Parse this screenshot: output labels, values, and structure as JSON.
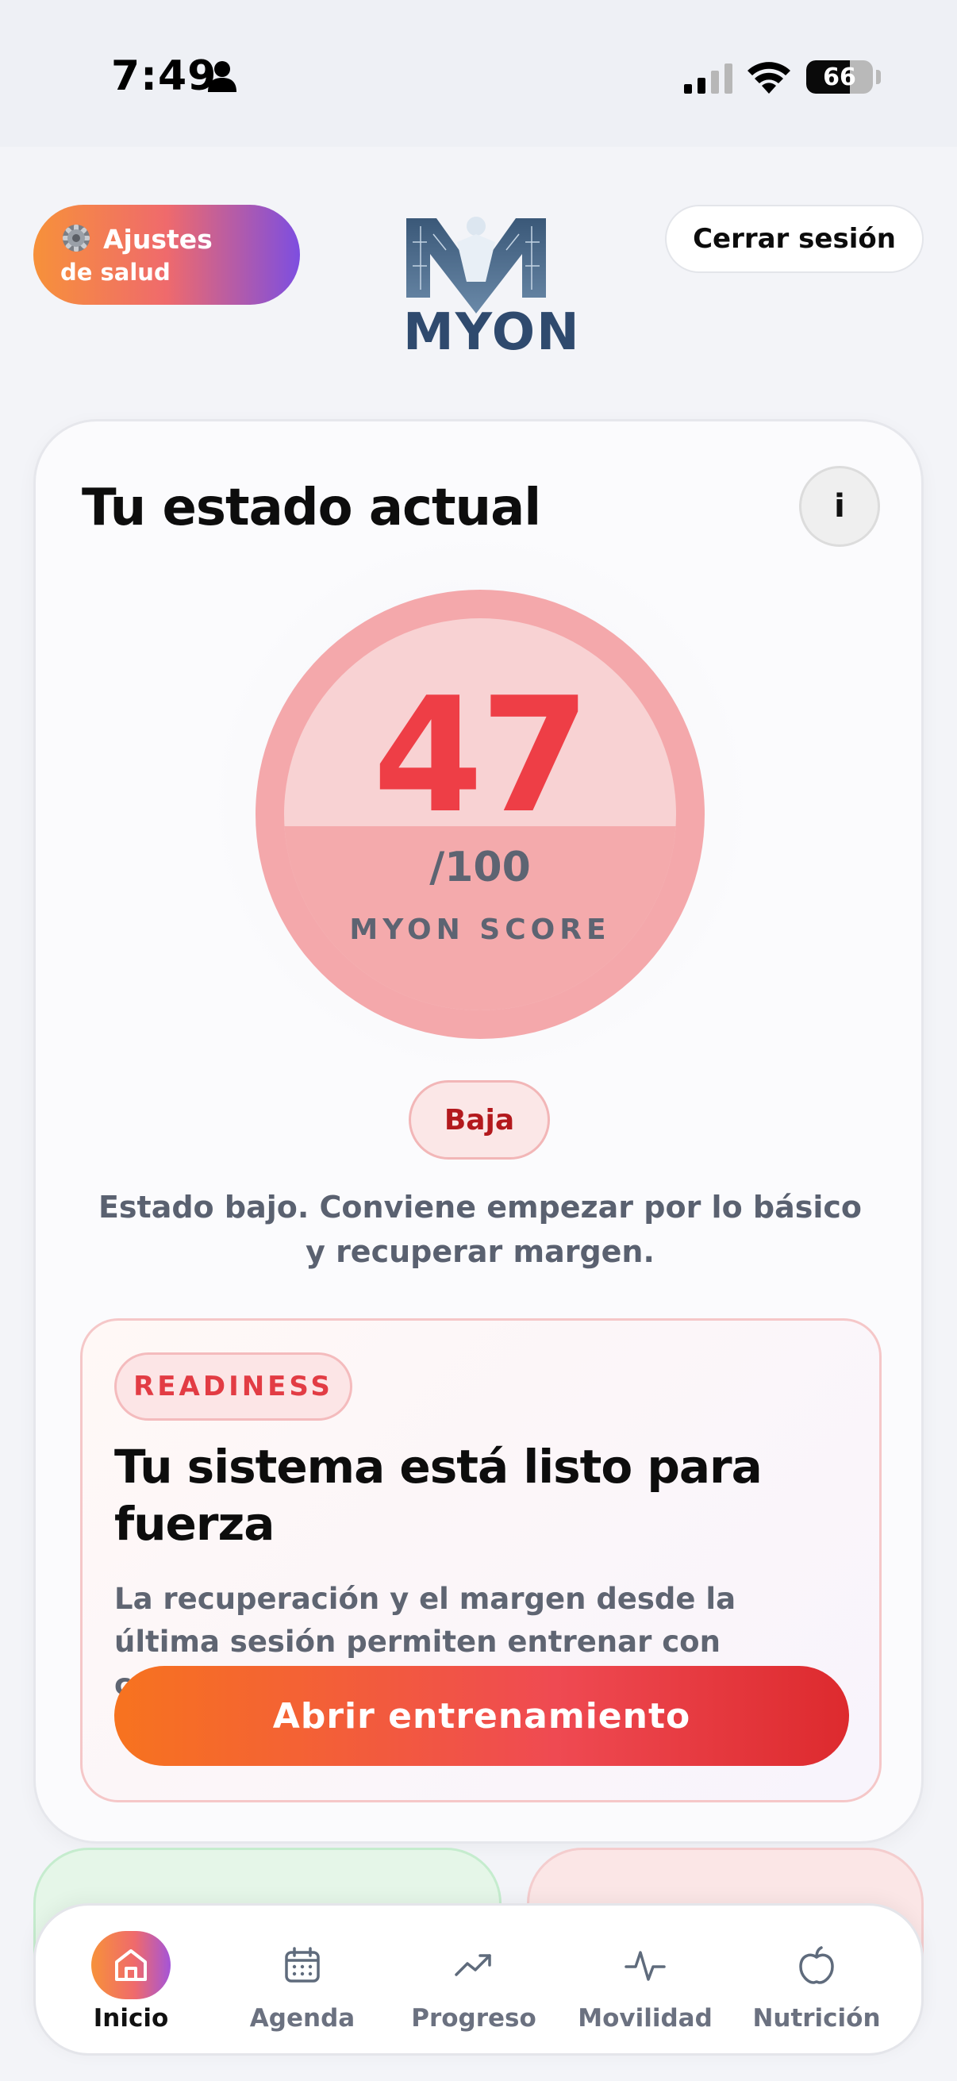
{
  "status_bar": {
    "time": "7:49",
    "battery": "66",
    "battery_level": 0.66
  },
  "header": {
    "health_button": {
      "line1": "Ajustes",
      "line2": "de salud"
    },
    "logo_text": "MYON",
    "logout_label": "Cerrar sesión"
  },
  "current_state": {
    "title": "Tu estado actual",
    "info_label": "i",
    "score": "47",
    "score_max": "/100",
    "score_label": "MYON SCORE",
    "score_fraction": 0.47,
    "level": "Baja",
    "description": "Estado bajo. Conviene empezar por lo básico y recuperar margen.",
    "accent_color": "#ee3e46"
  },
  "readiness": {
    "chip": "READINESS",
    "title": "Tu sistema está listo para fuerza",
    "description": "La recuperación y el margen desde la última sesión permiten entrenar con calidad.",
    "button_label": "Abrir entrenamiento"
  },
  "nav": {
    "items": [
      {
        "label": "Inicio",
        "icon": "home-icon",
        "active": true
      },
      {
        "label": "Agenda",
        "icon": "calendar-icon",
        "active": false
      },
      {
        "label": "Progreso",
        "icon": "trend-icon",
        "active": false
      },
      {
        "label": "Movilidad",
        "icon": "pulse-icon",
        "active": false
      },
      {
        "label": "Nutrición",
        "icon": "apple-icon",
        "active": false
      }
    ]
  }
}
